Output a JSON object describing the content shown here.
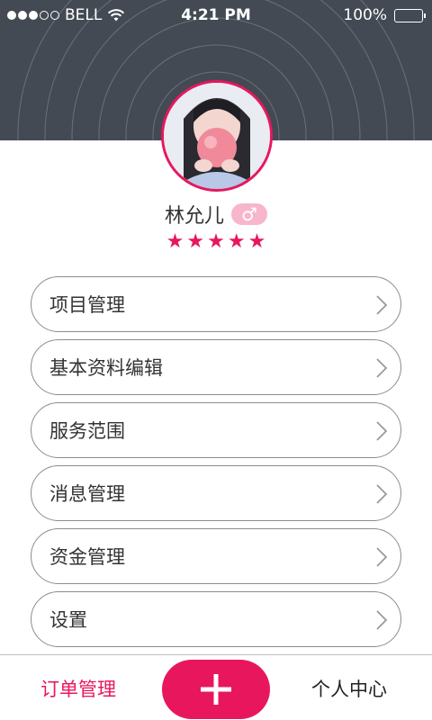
{
  "status_bar": {
    "carrier": "BELL",
    "time": "4:21 PM",
    "battery": "100%",
    "icons": [
      "signal-dots-icon",
      "wifi-icon",
      "battery-icon"
    ]
  },
  "profile": {
    "name": "林允儿",
    "gender_symbol": "♂",
    "rating_stars": 5,
    "avatar": "avatar-photo"
  },
  "menu": {
    "items": [
      {
        "label": "项目管理"
      },
      {
        "label": "基本资料编辑"
      },
      {
        "label": "服务范围"
      },
      {
        "label": "消息管理"
      },
      {
        "label": "资金管理"
      },
      {
        "label": "设置"
      }
    ],
    "chevron_icon": "chevron-right-icon"
  },
  "bottom_nav": {
    "orders_label": "订单管理",
    "add_icon": "plus-icon",
    "profile_label": "个人中心"
  },
  "colors": {
    "accent": "#e8175d",
    "header_bg": "#434a54",
    "badge_bg": "#f7b6cc",
    "border": "#8c8c8c"
  }
}
